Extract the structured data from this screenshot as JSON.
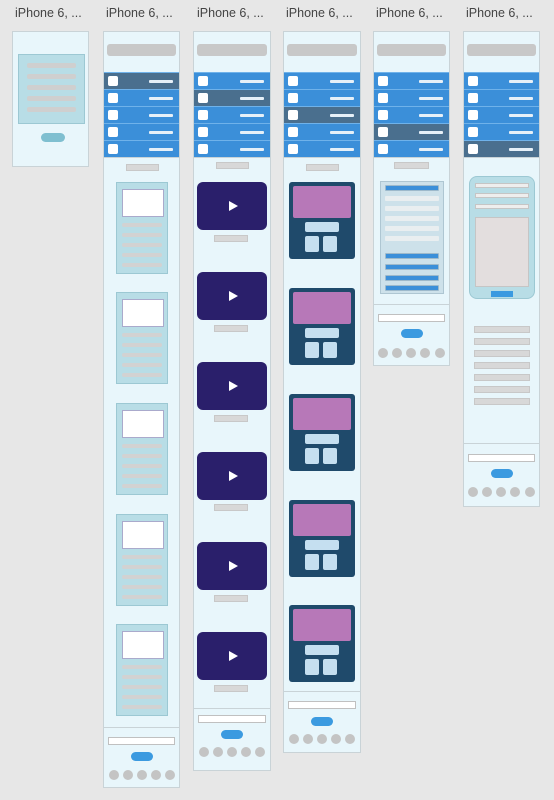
{
  "frames": [
    {
      "label": "iPhone 6, ...",
      "kind": "modal"
    },
    {
      "label": "iPhone 6, ...",
      "kind": "card-list"
    },
    {
      "label": "iPhone 6, ...",
      "kind": "video-list"
    },
    {
      "label": "iPhone 6, ...",
      "kind": "product-list"
    },
    {
      "label": "iPhone 6, ...",
      "kind": "tabs-table"
    },
    {
      "label": "iPhone 6, ...",
      "kind": "form"
    }
  ],
  "colors": {
    "canvas": "#e7e7e7",
    "frame_bg": "#e8f6fb",
    "nav_blue": "#3b8fd9",
    "nav_active": "#4a6f8e",
    "video": "#2a1f6b",
    "product_card": "#1f4a6b",
    "product_image": "#b778b8",
    "button_blue": "#3b9ae0"
  },
  "icons": [
    "play-icon",
    "checkbox-icon"
  ]
}
